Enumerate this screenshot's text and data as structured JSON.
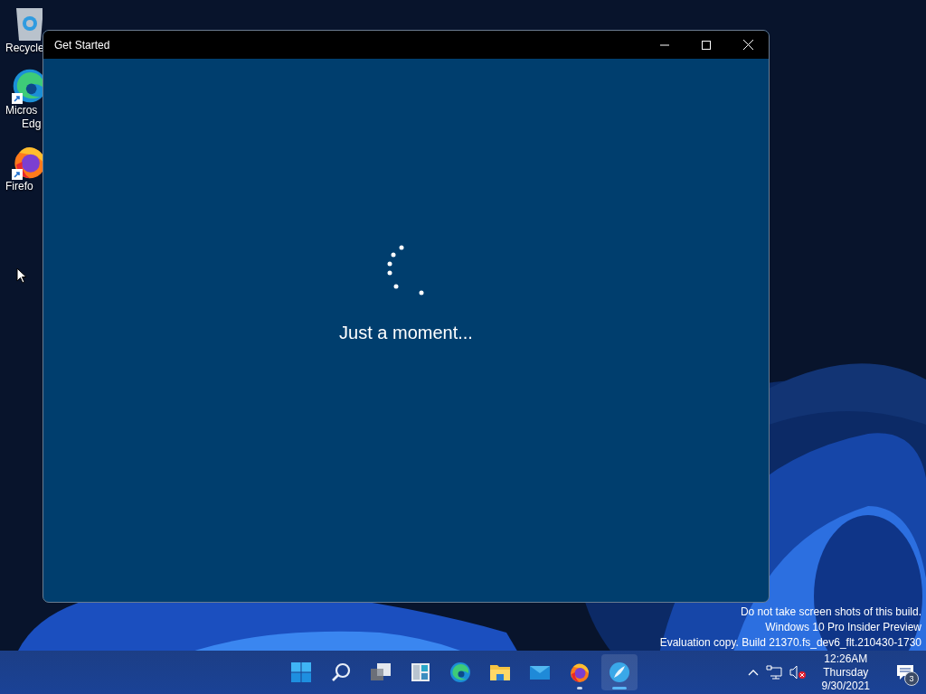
{
  "desktop_icons": [
    {
      "kind": "bin",
      "shortcut": false,
      "lines": [
        "Recycle"
      ]
    },
    {
      "kind": "edge",
      "shortcut": true,
      "lines": [
        "Micros",
        "Edg"
      ]
    },
    {
      "kind": "firefox",
      "shortcut": true,
      "lines": [
        "Firefo"
      ]
    }
  ],
  "window": {
    "title": "Get Started",
    "message": "Just a moment..."
  },
  "watermark": [
    "Do not take screen shots of this build.",
    "Windows 10 Pro Insider Preview",
    "Evaluation copy. Build 21370.fs_dev6_flt.210430-1730"
  ],
  "taskbar": {
    "apps": [
      {
        "kind": "start",
        "running": false,
        "selected": false
      },
      {
        "kind": "search",
        "running": false,
        "selected": false
      },
      {
        "kind": "taskview",
        "running": false,
        "selected": false
      },
      {
        "kind": "widgets",
        "running": false,
        "selected": false
      },
      {
        "kind": "edge",
        "running": false,
        "selected": false
      },
      {
        "kind": "folder",
        "running": false,
        "selected": false
      },
      {
        "kind": "mail",
        "running": false,
        "selected": false
      },
      {
        "kind": "firefox",
        "running": true,
        "selected": false
      },
      {
        "kind": "getstarted",
        "running": true,
        "selected": true
      }
    ],
    "tray": {
      "muted": true,
      "time": "12:26AM",
      "day": "Thursday",
      "date": "9/30/2021",
      "notifications": "3"
    }
  }
}
